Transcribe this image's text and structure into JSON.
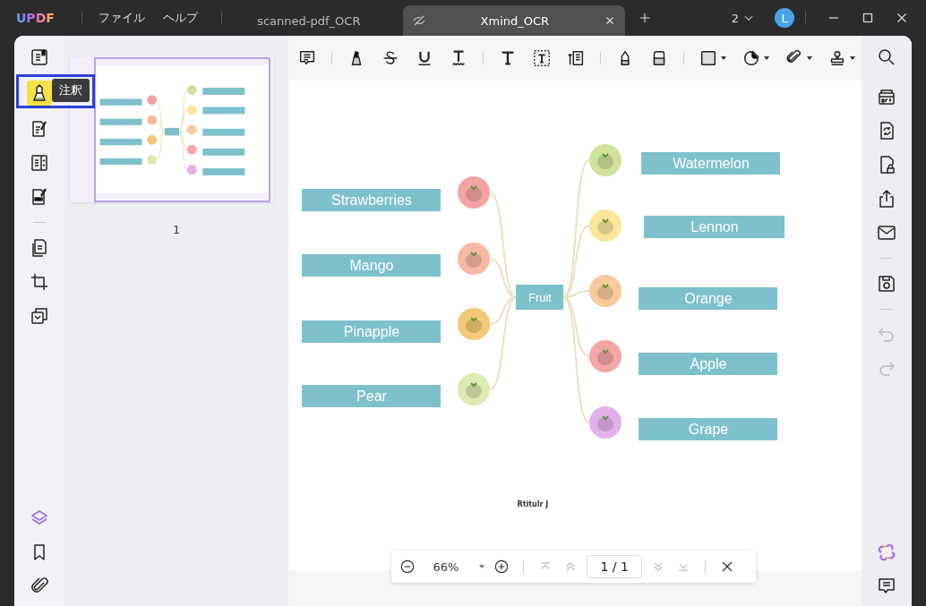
{
  "app": {
    "logo": "UPDF",
    "menu": [
      {
        "label": "ファイル"
      },
      {
        "label": "ヘルプ"
      }
    ]
  },
  "tabs": [
    {
      "label": "scanned-pdf_OCR",
      "selected": false
    },
    {
      "label": "Xmind_OCR",
      "selected": true
    }
  ],
  "window_count": "2",
  "user_initial": "L",
  "left_rail": {
    "tooltip": "注釈",
    "items": [
      {
        "kind": "reader",
        "selected": false
      },
      {
        "kind": "annotate",
        "selected": true
      },
      {
        "kind": "edit",
        "selected": false
      },
      {
        "kind": "form",
        "selected": false
      },
      {
        "kind": "redact",
        "selected": false
      },
      {
        "kind": "divider"
      },
      {
        "kind": "organize",
        "selected": false
      },
      {
        "kind": "crop",
        "selected": false
      },
      {
        "kind": "pages",
        "selected": false
      }
    ],
    "bottom": [
      {
        "kind": "layers"
      },
      {
        "kind": "bookmark"
      },
      {
        "kind": "attachment"
      }
    ]
  },
  "thumbnail": {
    "page_label": "1",
    "selected": true
  },
  "toolbar": [
    {
      "kind": "comment"
    },
    {
      "kind": "divider"
    },
    {
      "kind": "highlight"
    },
    {
      "kind": "strike"
    },
    {
      "kind": "underline"
    },
    {
      "kind": "squiggly"
    },
    {
      "kind": "divider"
    },
    {
      "kind": "text"
    },
    {
      "kind": "textbox"
    },
    {
      "kind": "callout"
    },
    {
      "kind": "divider"
    },
    {
      "kind": "pencil"
    },
    {
      "kind": "eraser"
    },
    {
      "kind": "divider"
    },
    {
      "kind": "shape"
    },
    {
      "kind": "sticker"
    },
    {
      "kind": "attach"
    },
    {
      "kind": "stamp"
    }
  ],
  "mindmap": {
    "center": "Fruit",
    "left": [
      {
        "label": "Strawberries",
        "color": "#f4a3a3"
      },
      {
        "label": "Mango",
        "color": "#f6b9a4"
      },
      {
        "label": "Pinapple",
        "color": "#f3c877"
      },
      {
        "label": "Pear",
        "color": "#dcebb2"
      }
    ],
    "right": [
      {
        "label": "Watermelon",
        "color": "#cfe39c"
      },
      {
        "label": "Lennon",
        "color": "#fbe799"
      },
      {
        "label": "Orange",
        "color": "#f8ca9c"
      },
      {
        "label": "Apple",
        "color": "#f5a6a6"
      },
      {
        "label": "Grape",
        "color": "#e3b1e9"
      }
    ],
    "footer": "Rtitulr J"
  },
  "zoom_bar": {
    "zoom": "66%",
    "page": "1 / 1"
  },
  "right_rail": [
    {
      "kind": "ocr",
      "disabled": false
    },
    {
      "kind": "convert",
      "disabled": false
    },
    {
      "kind": "protect",
      "disabled": false
    },
    {
      "kind": "share",
      "disabled": false
    },
    {
      "kind": "email",
      "disabled": false
    },
    {
      "kind": "divider"
    },
    {
      "kind": "save",
      "disabled": false
    },
    {
      "kind": "divider"
    },
    {
      "kind": "undo",
      "disabled": true
    },
    {
      "kind": "redo",
      "disabled": true
    }
  ],
  "right_bottom": [
    {
      "kind": "ai"
    },
    {
      "kind": "chat"
    }
  ]
}
